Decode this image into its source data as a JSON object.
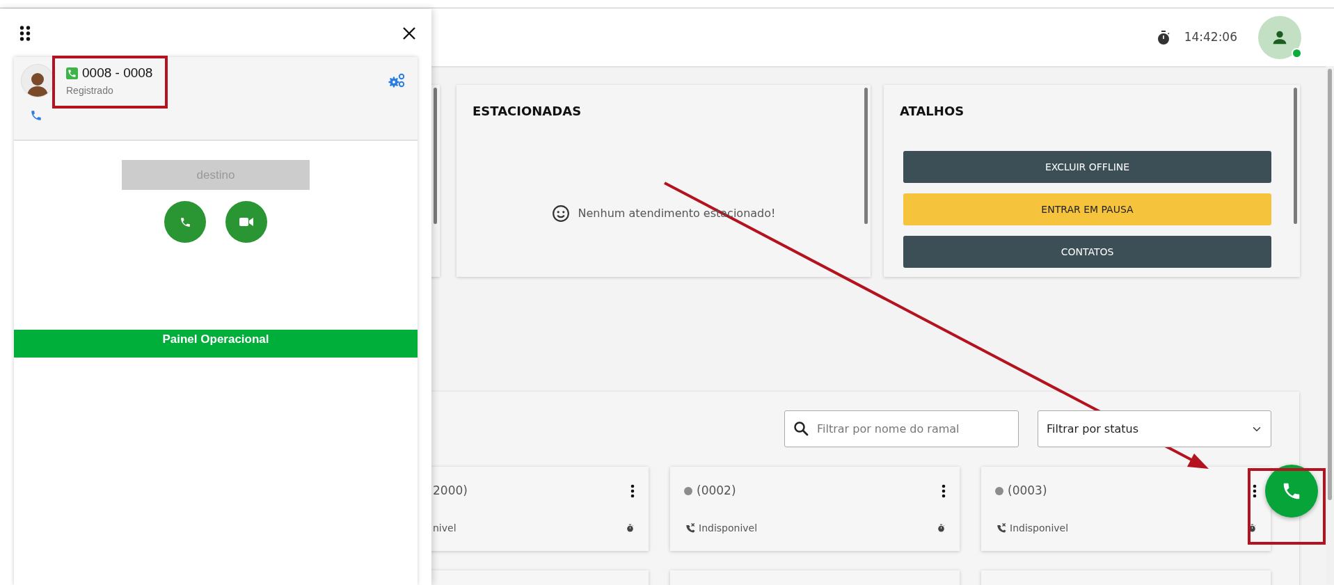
{
  "header": {
    "time": "14:42:06",
    "user": {
      "online": true
    }
  },
  "parked": {
    "title": "ESTACIONADAS",
    "empty_message": "Nenhum atendimento estacionado!"
  },
  "shortcuts": {
    "title": "ATALHOS",
    "buttons": [
      {
        "label": "EXCLUIR OFFLINE",
        "kind": "dark"
      },
      {
        "label": "ENTRAR EM PAUSA",
        "kind": "warning"
      },
      {
        "label": "CONTATOS",
        "kind": "dark"
      }
    ]
  },
  "extensions": {
    "search": {
      "placeholder": "Filtrar por nome do ramal"
    },
    "status_filter": {
      "value": "Filtrar por status"
    },
    "cards": [
      {
        "name": "2000)",
        "status": "nivel"
      },
      {
        "name": "(0002)",
        "status": "Indisponivel",
        "color": "#8c8c8c"
      },
      {
        "name": "(0003)",
        "status": "Indisponivel",
        "color": "#8c8c8c"
      }
    ]
  },
  "softphone": {
    "extension": "0008 - 0008",
    "status": "Registrado",
    "destination": {
      "placeholder": "destino",
      "disabled": true
    },
    "banner": "Painel Operacional"
  }
}
